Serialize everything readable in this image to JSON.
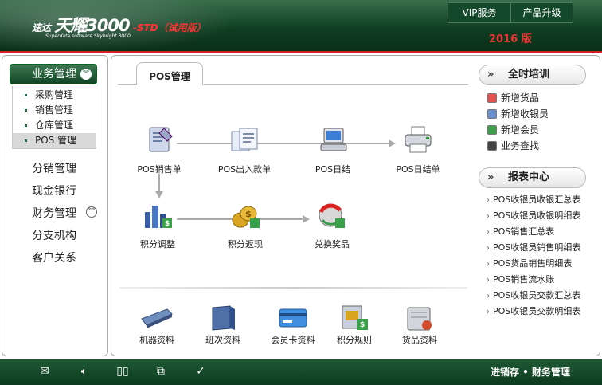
{
  "header": {
    "logo_brand": "速达",
    "logo_title": "天耀3000",
    "logo_std": "-STD（试用版）",
    "logo_subtitle": "Superdata software Skybright 3000",
    "vip_label": "VIP服务",
    "upgrade_label": "产品升级",
    "edition": "2016 版"
  },
  "nav": {
    "active_group": "业务管理",
    "sub_items": [
      "采购管理",
      "销售管理",
      "仓库管理",
      "POS 管理"
    ],
    "selected_sub": "POS 管理",
    "groups": [
      "分销管理",
      "现金银行",
      "财务管理",
      "分支机构",
      "客户关系"
    ]
  },
  "main": {
    "tab_label": "POS管理",
    "flow": {
      "pos_sale": "POS销售单",
      "pos_inout": "POS出入款单",
      "pos_daily": "POS日结",
      "pos_daily_sheet": "POS日结单",
      "points_adjust": "积分调整",
      "points_cashback": "积分返现",
      "redeem_prize": "兑换奖品"
    },
    "bottom_items": [
      "机器资料",
      "班次资料",
      "会员卡资料",
      "积分规则",
      "货品资料"
    ]
  },
  "right": {
    "training_title": "全时培训",
    "training_items": [
      "新增货品",
      "新增收银员",
      "新增会员",
      "业务查找"
    ],
    "report_title": "报表中心",
    "report_items": [
      "POS收银员收银汇总表",
      "POS收银员收银明细表",
      "POS销售汇总表",
      "POS收银员销售明细表",
      "POS货品销售明细表",
      "POS销售流水账",
      "POS收银员交款汇总表",
      "POS收银员交款明细表"
    ]
  },
  "footer": {
    "icons": [
      "mail-icon",
      "speaker-icon",
      "book-icon",
      "copy-icon",
      "check-icon"
    ],
    "slogan": "进销存 • 财务管理"
  },
  "colors": {
    "header_green": "#0f3f22",
    "footer_green": "#1f5a35",
    "accent_red": "#e33333"
  }
}
